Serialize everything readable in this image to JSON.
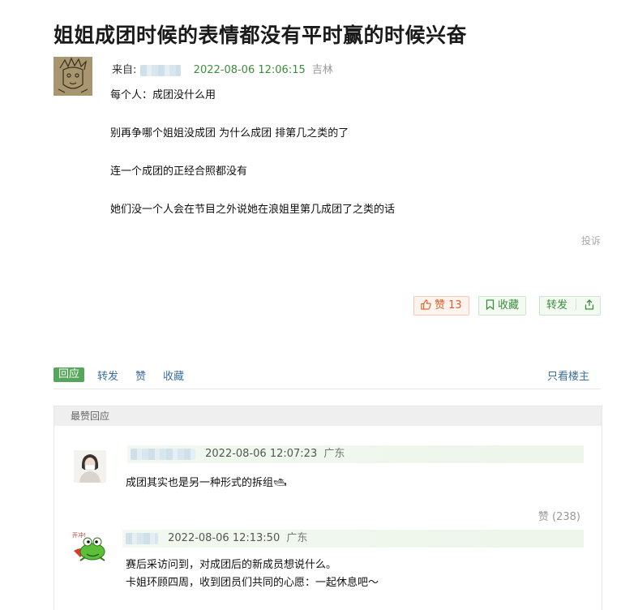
{
  "post": {
    "title": "姐姐成团时候的表情都没有平时赢的时候兴奋",
    "from_label": "来自:",
    "datetime": "2022-08-06 12:06:15",
    "location": "吉林",
    "paragraphs": [
      "每个人：成团没什么用",
      "别再争哪个姐姐没成团 为什么成团 排第几之类的了",
      "连一个成团的正经合照都没有",
      "她们没一个人会在节目之外说她在浪姐里第几成团了之类的话"
    ],
    "report_label": "投诉"
  },
  "actions": {
    "like_label": "赞",
    "like_count": "13",
    "collect_label": "收藏",
    "forward_label": "转发"
  },
  "tabs": {
    "reply": "回应",
    "forward": "转发",
    "like": "赞",
    "collect": "收藏",
    "only_op": "只看楼主"
  },
  "hot_replies": {
    "header": "最赞回应",
    "items": [
      {
        "datetime": "2022-08-06 12:07:23",
        "location": "广东",
        "text": "成团其实也是另一种形式的拆组🛥",
        "like_label": "赞 (238)"
      },
      {
        "datetime": "2022-08-06 12:13:50",
        "location": "广东",
        "lines": [
          "赛后采访问到，对成团后的新成员想说什么。",
          "卡姐环顾四周，收到团员们共同的心愿：一起休息吧～"
        ],
        "avatar_text": "开冲!"
      }
    ]
  },
  "colors": {
    "accent_green": "#3c8d3c",
    "tab_active_bg": "#55a55a",
    "link_blue": "#3c6f9e",
    "like_orange": "#d9602a"
  }
}
